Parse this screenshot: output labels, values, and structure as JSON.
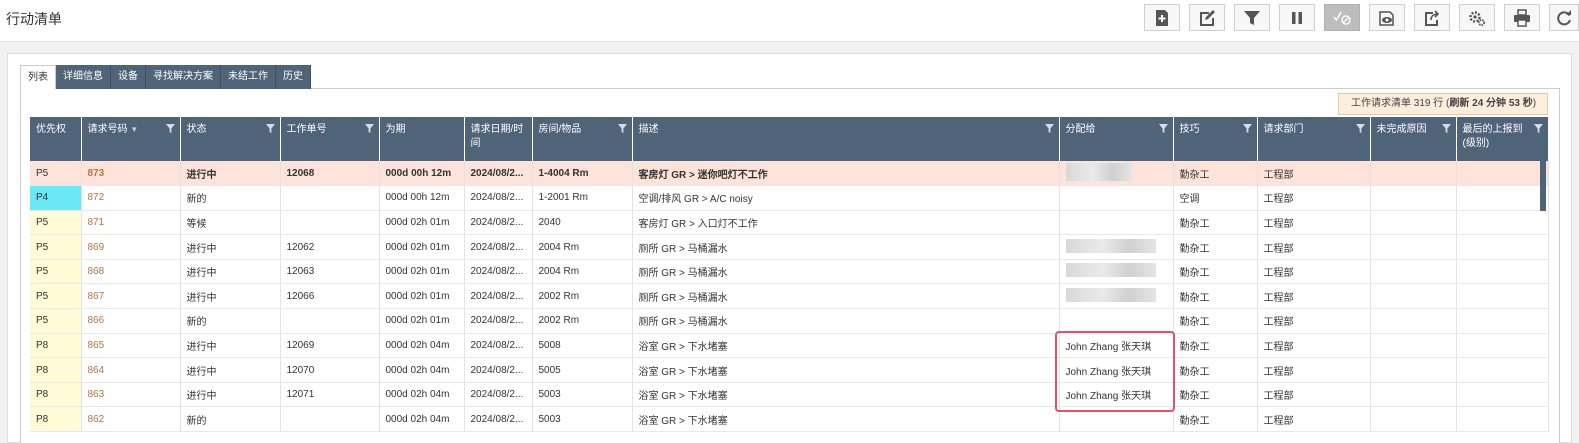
{
  "page": {
    "title": "行动清单"
  },
  "toolbar": {
    "buttons": [
      {
        "name": "add",
        "icon": "add-icon"
      },
      {
        "name": "edit",
        "icon": "edit-icon"
      },
      {
        "name": "filter",
        "icon": "filter-icon"
      },
      {
        "name": "pause",
        "icon": "pause-icon"
      },
      {
        "name": "complete",
        "icon": "complete-icon",
        "disabled": true
      },
      {
        "name": "view",
        "icon": "view-icon"
      },
      {
        "name": "export",
        "icon": "export-icon"
      },
      {
        "name": "settings",
        "icon": "gear-icon"
      },
      {
        "name": "print",
        "icon": "print-icon"
      },
      {
        "name": "refresh",
        "icon": "refresh-icon"
      }
    ]
  },
  "tabs": [
    "列表",
    "详细信息",
    "设备",
    "寻找解决方案",
    "未结工作",
    "历史"
  ],
  "summary": {
    "prefix": "工作请求清单 319 行 (",
    "refresh": "刷新 24 分钟 53 秒",
    "suffix": ")"
  },
  "columns": [
    "优先权",
    "请求号码",
    "状态",
    "工作单号",
    "为期",
    "请求日期/时间",
    "房间/物品",
    "描述",
    "分配给",
    "技巧",
    "请求部门",
    "未完成原因",
    "最后的上报到(级别)"
  ],
  "rows": [
    {
      "priority": "P5",
      "request_no": "873",
      "status": "进行中",
      "work_order": "12068",
      "duration": "000d 00h 12m",
      "date": "2024/08/2...",
      "room": "1-4004 Rm",
      "description": "客房灯 GR > 迷你吧灯不工作",
      "assigned": "",
      "skill": "勤杂工",
      "dept": "工程部",
      "reason": "",
      "escalation": ""
    },
    {
      "priority": "P4",
      "request_no": "872",
      "status": "新的",
      "work_order": "",
      "duration": "000d 00h 12m",
      "date": "2024/08/2...",
      "room": "1-2001 Rm",
      "description": "空调/排风 GR > A/C noisy",
      "assigned": "",
      "skill": "空调",
      "dept": "工程部",
      "reason": "",
      "escalation": ""
    },
    {
      "priority": "P5",
      "request_no": "871",
      "status": "等候",
      "work_order": "",
      "duration": "000d 02h 01m",
      "date": "2024/08/2...",
      "room": "2040",
      "description": "客房灯 GR > 入口灯不工作",
      "assigned": "",
      "skill": "勤杂工",
      "dept": "工程部",
      "reason": "",
      "escalation": ""
    },
    {
      "priority": "P5",
      "request_no": "869",
      "status": "进行中",
      "work_order": "12062",
      "duration": "000d 02h 01m",
      "date": "2024/08/2...",
      "room": "2004 Rm",
      "description": "厕所 GR > 马桶漏水",
      "assigned": "",
      "skill": "勤杂工",
      "dept": "工程部",
      "reason": "",
      "escalation": ""
    },
    {
      "priority": "P5",
      "request_no": "868",
      "status": "进行中",
      "work_order": "12063",
      "duration": "000d 02h 01m",
      "date": "2024/08/2...",
      "room": "2004 Rm",
      "description": "厕所 GR > 马桶漏水",
      "assigned": "",
      "skill": "勤杂工",
      "dept": "工程部",
      "reason": "",
      "escalation": ""
    },
    {
      "priority": "P5",
      "request_no": "867",
      "status": "进行中",
      "work_order": "12066",
      "duration": "000d 02h 01m",
      "date": "2024/08/2...",
      "room": "2002 Rm",
      "description": "厕所 GR > 马桶漏水",
      "assigned": "",
      "skill": "勤杂工",
      "dept": "工程部",
      "reason": "",
      "escalation": ""
    },
    {
      "priority": "P5",
      "request_no": "866",
      "status": "新的",
      "work_order": "",
      "duration": "000d 02h 01m",
      "date": "2024/08/2...",
      "room": "2002 Rm",
      "description": "厕所 GR > 马桶漏水",
      "assigned": "",
      "skill": "勤杂工",
      "dept": "工程部",
      "reason": "",
      "escalation": ""
    },
    {
      "priority": "P8",
      "request_no": "865",
      "status": "进行中",
      "work_order": "12069",
      "duration": "000d 02h 04m",
      "date": "2024/08/2...",
      "room": "5008",
      "description": "浴室 GR > 下水堵塞",
      "assigned": "John Zhang 张天琪",
      "skill": "勤杂工",
      "dept": "工程部",
      "reason": "",
      "escalation": ""
    },
    {
      "priority": "P8",
      "request_no": "864",
      "status": "进行中",
      "work_order": "12070",
      "duration": "000d 02h 04m",
      "date": "2024/08/2...",
      "room": "5005",
      "description": "浴室 GR > 下水堵塞",
      "assigned": "John Zhang 张天琪",
      "skill": "勤杂工",
      "dept": "工程部",
      "reason": "",
      "escalation": ""
    },
    {
      "priority": "P8",
      "request_no": "863",
      "status": "进行中",
      "work_order": "12071",
      "duration": "000d 02h 04m",
      "date": "2024/08/2...",
      "room": "5003",
      "description": "浴室 GR > 下水堵塞",
      "assigned": "John Zhang 张天琪",
      "skill": "勤杂工",
      "dept": "工程部",
      "reason": "",
      "escalation": ""
    },
    {
      "priority": "P8",
      "request_no": "862",
      "status": "新的",
      "work_order": "",
      "duration": "000d 02h 04m",
      "date": "2024/08/2...",
      "room": "5003",
      "description": "浴室 GR > 下水堵塞",
      "assigned": "",
      "skill": "勤杂工",
      "dept": "工程部",
      "reason": "",
      "escalation": ""
    }
  ],
  "colors": {
    "header_bg": "#4f6478",
    "highlight_row": "#fde3da",
    "request_link": "#b8743e",
    "p4_badge": "#6be8f5",
    "annotation_box": "#e8506a"
  }
}
